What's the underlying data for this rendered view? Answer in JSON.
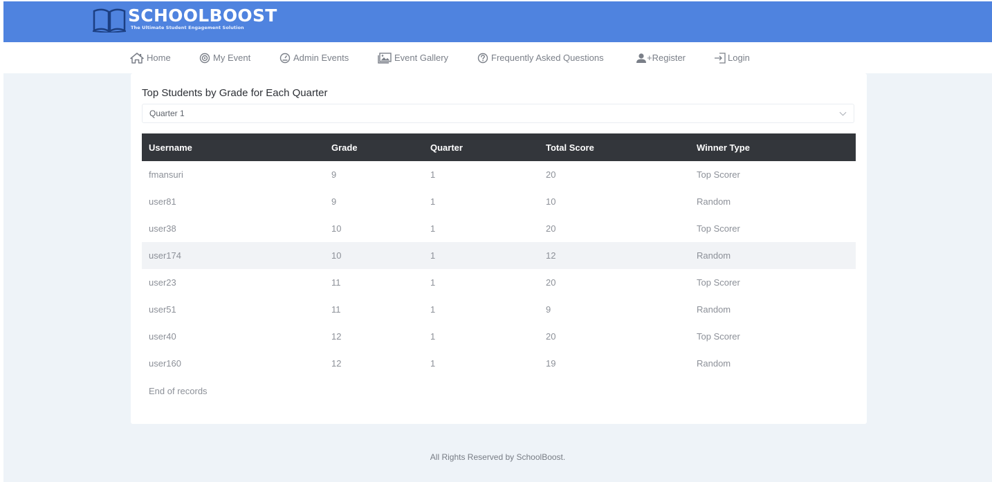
{
  "brand": {
    "name": "SCHOOLBOOST",
    "tagline": "The Ultimate Student Engagement Solution",
    "header_color": "#4f83df"
  },
  "nav": {
    "items": [
      {
        "label": "Home",
        "icon": "home-icon"
      },
      {
        "label": "My Event",
        "icon": "target-icon"
      },
      {
        "label": "Admin Events",
        "icon": "gauge-icon"
      },
      {
        "label": "Event Gallery",
        "icon": "gallery-icon"
      },
      {
        "label": "Frequently Asked Questions",
        "icon": "question-icon"
      },
      {
        "label": "+Register",
        "icon": "user-icon"
      },
      {
        "label": "Login",
        "icon": "login-icon"
      }
    ]
  },
  "main": {
    "title": "Top Students by Grade for Each Quarter",
    "quarter_select": {
      "selected": "Quarter 1"
    },
    "table": {
      "headers": [
        "Username",
        "Grade",
        "Quarter",
        "Total Score",
        "Winner Type"
      ],
      "rows": [
        [
          "fmansuri",
          "9",
          "1",
          "20",
          "Top Scorer"
        ],
        [
          "user81",
          "9",
          "1",
          "10",
          "Random"
        ],
        [
          "user38",
          "10",
          "1",
          "20",
          "Top Scorer"
        ],
        [
          "user174",
          "10",
          "1",
          "12",
          "Random"
        ],
        [
          "user23",
          "11",
          "1",
          "20",
          "Top Scorer"
        ],
        [
          "user51",
          "11",
          "1",
          "9",
          "Random"
        ],
        [
          "user40",
          "12",
          "1",
          "20",
          "Top Scorer"
        ],
        [
          "user160",
          "12",
          "1",
          "19",
          "Random"
        ]
      ]
    },
    "end_note": "End of records"
  },
  "footer": {
    "text": "All Rights Reserved by SchoolBoost."
  }
}
